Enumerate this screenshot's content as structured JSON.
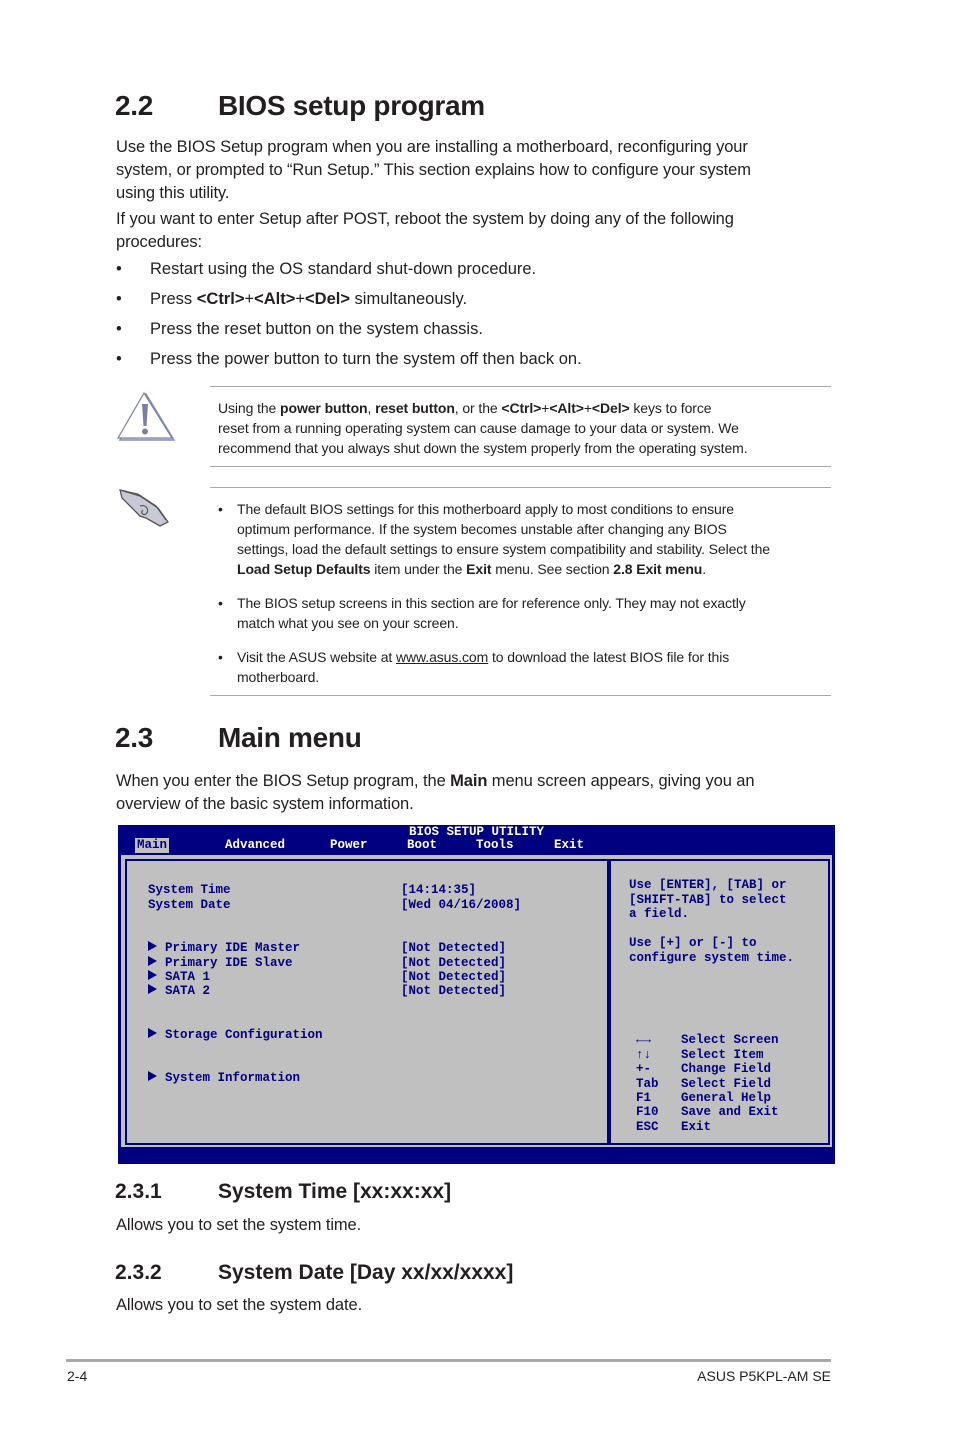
{
  "section_2_2": {
    "number": "2.2",
    "title": "BIOS setup program",
    "para1_lines": [
      "Use the BIOS Setup program when you are installing a motherboard, reconfiguring your",
      "system, or prompted to “Run Setup.” This section explains how to configure your system",
      "using this utility."
    ],
    "para2_lines": [
      "If you want to enter Setup after POST, reboot the system by doing any of the following",
      "procedures:"
    ],
    "bullets": {
      "b1": "Restart using the OS standard shut-down procedure.",
      "b2_pre": "Press ",
      "b2_bold": "<Ctrl>",
      "b2_plus1": "+",
      "b2_bold2": "<Alt>",
      "b2_plus2": "+",
      "b2_bold3": "<Del>",
      "b2_post": " simultaneously.",
      "b3": "Press the reset button on the system chassis.",
      "b4": "Press the power button to turn the system off then back on."
    },
    "bullet_char": "•"
  },
  "warning": {
    "l1_a": "Using the ",
    "l1_b": "power button",
    "l1_c": ", ",
    "l1_d": "reset button",
    "l1_e": ", or the ",
    "l1_f": "<Ctrl>",
    "l1_g": "+",
    "l1_h": "<Alt>",
    "l1_i": "+",
    "l1_j": "<Del>",
    "l1_k": " keys to force",
    "l2": "reset from a running operating system can cause damage to your data or system. We",
    "l3": "recommend that you always shut down the system properly from the operating system."
  },
  "note": {
    "n1_l1": "The default BIOS settings for this motherboard apply to most conditions to ensure",
    "n1_l2": "optimum performance. If the system becomes unstable after changing any BIOS",
    "n1_l3": "settings, load the default settings to ensure system compatibility and stability. Select the",
    "n1_l4_a": "Load Setup Defaults",
    "n1_l4_b": " item under the ",
    "n1_l4_c": "Exit",
    "n1_l4_d": " menu. See section ",
    "n1_l4_e": "2.8 Exit menu",
    "n1_l4_f": ".",
    "n2_l1": "The BIOS setup screens in this section are for reference only. They may not exactly",
    "n2_l2": "match what you see on your screen.",
    "n3_l1_a": "Visit the ASUS website at ",
    "n3_l1_link": "www.asus.com",
    "n3_l1_b": " to download the latest BIOS file for this",
    "n3_l2": "motherboard."
  },
  "section_2_3": {
    "number": "2.3",
    "title": "Main menu",
    "intro_a": "When you enter the BIOS Setup program, the ",
    "intro_bold": "Main",
    "intro_b": " menu screen appears, giving you an",
    "intro_l2": "overview of the basic system information."
  },
  "bios": {
    "title": "BIOS SETUP UTILITY",
    "tabs": [
      "Main",
      "Advanced",
      "Power",
      "Boot",
      "Tools",
      "Exit"
    ],
    "active_tab": "Main",
    "items": [
      {
        "label": "System Time",
        "value": "[14:14:35]"
      },
      {
        "label": "System Date",
        "value": "[Wed 04/16/2008]"
      }
    ],
    "submenus": [
      {
        "label": "Primary IDE Master",
        "value": "[Not Detected]"
      },
      {
        "label": "Primary IDE Slave",
        "value": "[Not Detected]"
      },
      {
        "label": "SATA 1",
        "value": "[Not Detected]"
      },
      {
        "label": "SATA 2",
        "value": "[Not Detected]"
      },
      {
        "label": "Storage Configuration",
        "value": ""
      },
      {
        "label": "System Information",
        "value": ""
      }
    ],
    "help": [
      "Use [ENTER], [TAB] or",
      "[SHIFT-TAB] to select",
      "a field.",
      "",
      "Use [+] or [-] to",
      "configure system time."
    ],
    "keys": [
      {
        "key": "←→",
        "action": "Select Screen"
      },
      {
        "key": "↑↓",
        "action": "Select Item"
      },
      {
        "key": "+-",
        "action": "Change Field"
      },
      {
        "key": "Tab",
        "action": "Select Field"
      },
      {
        "key": "F1",
        "action": "General Help"
      },
      {
        "key": "F10",
        "action": "Save and Exit"
      },
      {
        "key": "ESC",
        "action": "Exit"
      }
    ],
    "colors": {
      "frame": "#000080",
      "panel": "#c0c0c0",
      "text": "#000080"
    }
  },
  "section_2_3_1": {
    "number": "2.3.1",
    "title": "System Time [xx:xx:xx]",
    "desc": "Allows you to set the system time."
  },
  "section_2_3_2": {
    "number": "2.3.2",
    "title": "System Date [Day xx/xx/xxxx]",
    "desc": "Allows you to set the system date."
  },
  "footer": {
    "page": "2-4",
    "product": "ASUS P5KPL-AM SE"
  }
}
